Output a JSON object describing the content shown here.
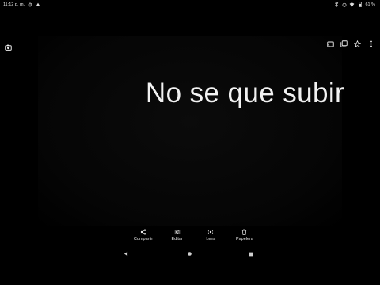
{
  "status": {
    "time": "11:12 p. m.",
    "battery": "61 %"
  },
  "photo": {
    "text": "No se que subir"
  },
  "actions": [
    {
      "label": "Compartir",
      "icon": "share-icon"
    },
    {
      "label": "Editar",
      "icon": "tune-icon"
    },
    {
      "label": "Lens",
      "icon": "lens-icon"
    },
    {
      "label": "Papelera",
      "icon": "trash-icon"
    }
  ],
  "toolbar": {
    "icons": [
      "camera-icon",
      "cast-icon",
      "copy-icon",
      "star-icon",
      "more-vert-icon"
    ]
  },
  "colors": {
    "background": "#000000",
    "text": "#f2f2f2"
  }
}
